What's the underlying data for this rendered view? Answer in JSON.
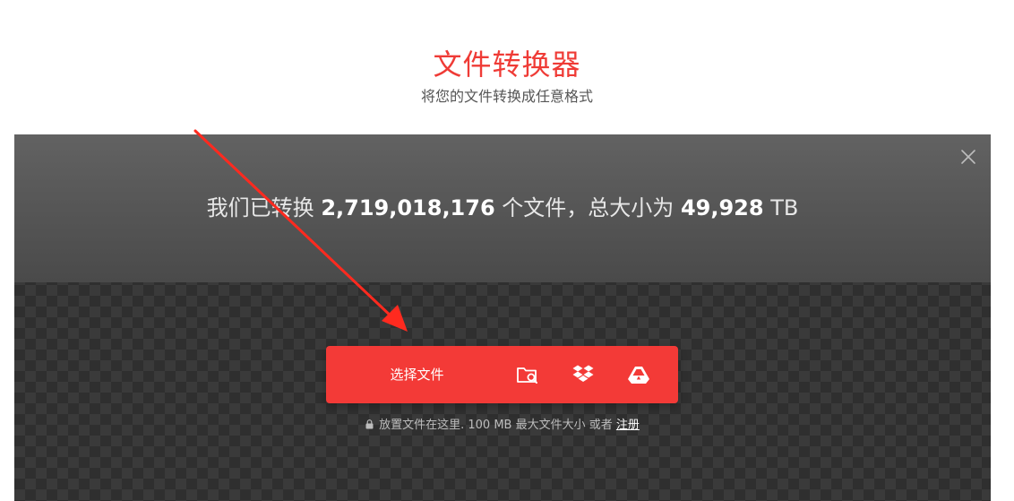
{
  "hero": {
    "title": "文件转换器",
    "subtitle": "将您的文件转换成任意格式"
  },
  "stats": {
    "prefix": "我们已转换",
    "files_count": "2,719,018,176",
    "middle": "个文件，总大小为",
    "total_size": "49,928",
    "unit": "TB"
  },
  "upload": {
    "choose_label": "选择文件",
    "sources": [
      "folder-search-icon",
      "dropbox-icon",
      "google-drive-icon"
    ]
  },
  "hint": {
    "text": "放置文件在这里. 100 MB 最大文件大小 或者",
    "signup": "注册"
  },
  "colors": {
    "accent": "#f33a37",
    "title": "#ef3b36",
    "arrow": "#ff2a1f"
  }
}
